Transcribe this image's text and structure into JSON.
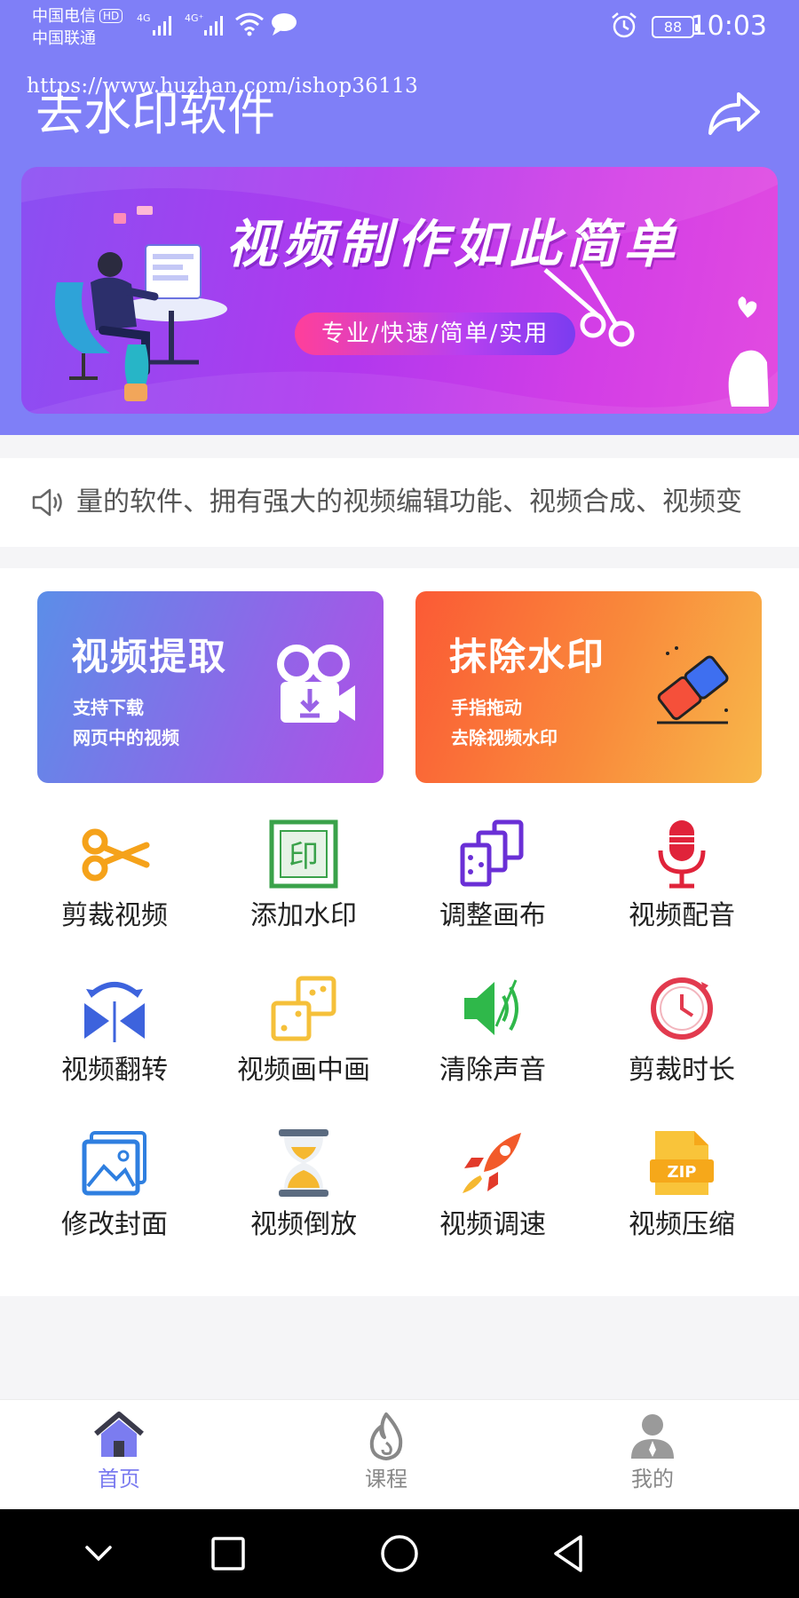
{
  "status_bar": {
    "carrier_1": "中国电信",
    "carrier_1_badge": "HD",
    "carrier_2": "中国联通",
    "signal_1_label": "4G",
    "signal_2_label": "4G⁺",
    "battery": "88",
    "time": "10:03"
  },
  "watermark_url": "https://www.huzhan.com/ishop36113",
  "header": {
    "title": "去水印软件"
  },
  "banner": {
    "title": "视频制作如此简单",
    "tagline": "专业/快速/简单/实用"
  },
  "notice": {
    "text": "量的软件、拥有强大的视频编辑功能、视频合成、视频变"
  },
  "feature_cards": [
    {
      "title": "视频提取",
      "line1": "支持下载",
      "line2": "网页中的视频"
    },
    {
      "title": "抹除水印",
      "line1": "手指拖动",
      "line2": "去除视频水印"
    }
  ],
  "tools": [
    {
      "label": "剪裁视频",
      "icon": "scissors-icon"
    },
    {
      "label": "添加水印",
      "icon": "stamp-icon"
    },
    {
      "label": "调整画布",
      "icon": "canvas-icon"
    },
    {
      "label": "视频配音",
      "icon": "microphone-icon"
    },
    {
      "label": "视频翻转",
      "icon": "flip-icon"
    },
    {
      "label": "视频画中画",
      "icon": "pip-icon"
    },
    {
      "label": "清除声音",
      "icon": "speaker-icon"
    },
    {
      "label": "剪裁时长",
      "icon": "clock-icon"
    },
    {
      "label": "修改封面",
      "icon": "image-icon"
    },
    {
      "label": "视频倒放",
      "icon": "hourglass-icon"
    },
    {
      "label": "视频调速",
      "icon": "rocket-icon"
    },
    {
      "label": "视频压缩",
      "icon": "zip-icon"
    }
  ],
  "tabbar": [
    {
      "label": "首页",
      "icon": "home-icon",
      "active": true
    },
    {
      "label": "课程",
      "icon": "flame-icon",
      "active": false
    },
    {
      "label": "我的",
      "icon": "user-icon",
      "active": false
    }
  ],
  "colors": {
    "header_bg": "#7f7ff7",
    "accent": "#7b7cf0",
    "card_blue": "#6d7ce8",
    "card_orange": "#fb7a3a"
  }
}
